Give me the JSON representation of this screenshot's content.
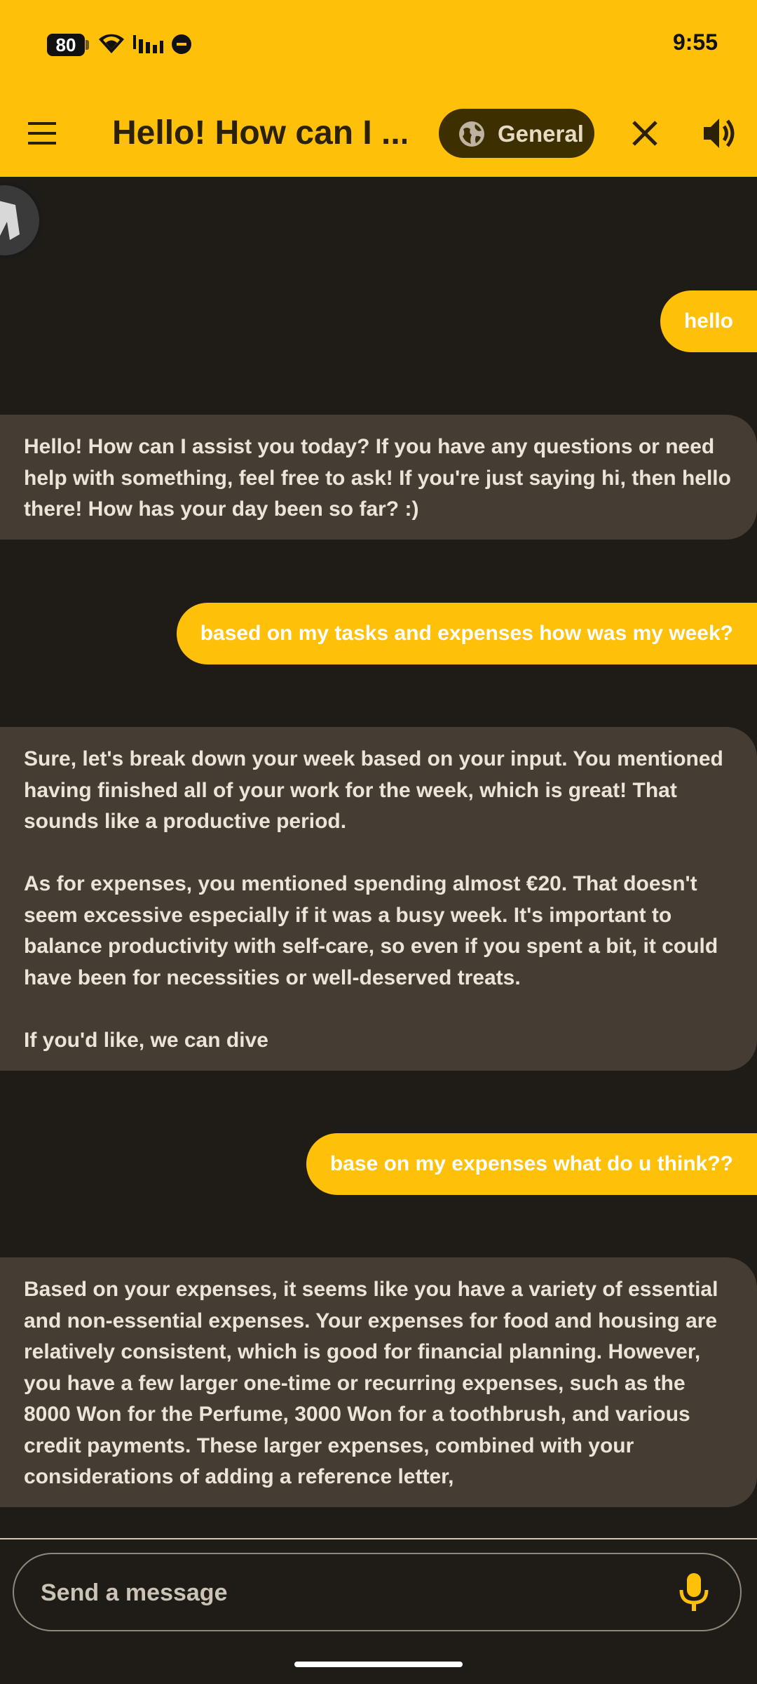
{
  "status_bar": {
    "battery": "80",
    "time": "9:55"
  },
  "app_bar": {
    "title": "Hello! How can I ...",
    "mode_chip": "General",
    "icons": [
      "menu-icon",
      "globe-icon",
      "close-icon",
      "speaker-icon"
    ]
  },
  "messages": [
    {
      "role": "user",
      "text": "hello"
    },
    {
      "role": "assistant",
      "text": "Hello! How can I assist you today? If you have any questions or need help with something, feel free to ask! If you're just saying hi, then hello there! How has your day been so far? :)"
    },
    {
      "role": "user",
      "text": "based on my tasks and expenses how was my week?"
    },
    {
      "role": "assistant",
      "text": "Sure, let's break down your week based on your input. You mentioned having finished all of your work for the week, which is great! That sounds like a productive period.\n\nAs for expenses, you mentioned spending almost €20. That doesn't seem excessive especially if it was a busy week. It's important to balance productivity with self-care, so even if you spent a bit, it could have been for necessities or well-deserved treats.\n\nIf you'd like, we can dive"
    },
    {
      "role": "user",
      "text": "base on my expenses what do u think??"
    },
    {
      "role": "assistant",
      "text": "Based on your expenses, it seems like you have a variety of essential and non-essential expenses. Your expenses for food and housing are relatively consistent, which is good for financial planning. However, you have a few larger one-time or recurring expenses, such as the 8000 Won for the Perfume, 3000 Won for a toothbrush, and various credit payments. These larger expenses, combined with your considerations of adding a reference letter,"
    }
  ],
  "composer": {
    "placeholder": "Send a message"
  },
  "colors": {
    "accent": "#fec008",
    "background": "#1f1b16",
    "assistant_bubble": "#453d33"
  }
}
